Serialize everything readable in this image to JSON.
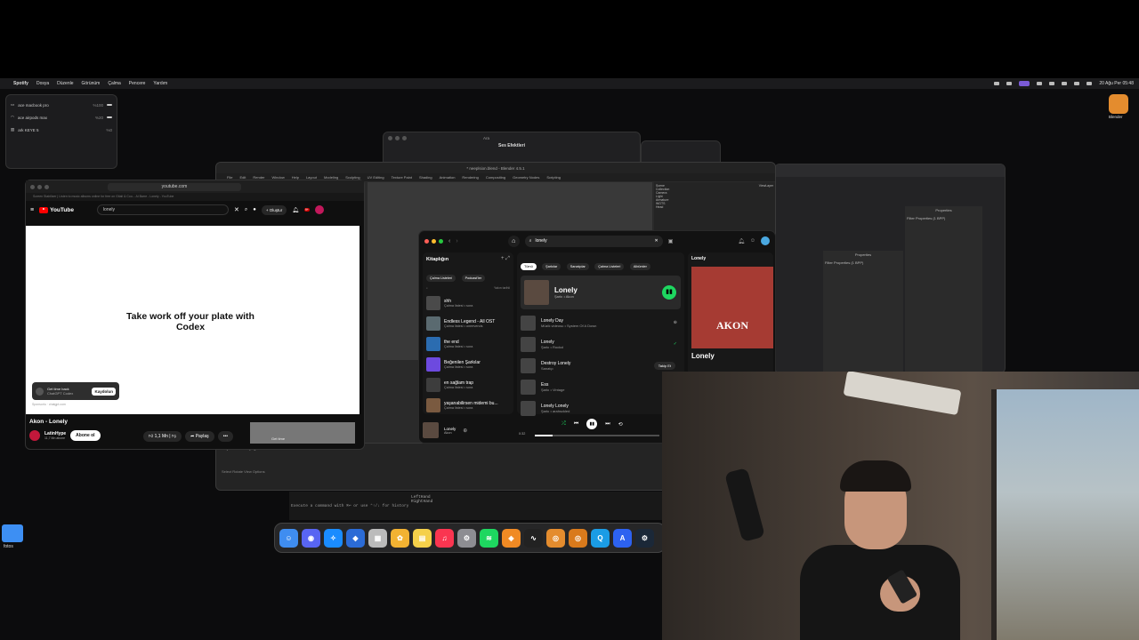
{
  "menubar": {
    "app": "Spotify",
    "items": [
      "Dosya",
      "Düzenle",
      "Görünüm",
      "Çalma",
      "Pencere",
      "Yardım"
    ],
    "clock": "20 Ağu Per  05:48"
  },
  "audio_popup": {
    "devices": [
      {
        "name": "ace macbook pro",
        "level": "%100"
      },
      {
        "name": "ace airpods max",
        "level": "%20"
      },
      {
        "name": "ark KEYE 5",
        "level": "%0"
      }
    ]
  },
  "desktop": {
    "folder_label": "fotos",
    "blender_label": "Blender"
  },
  "back_window": {
    "title": "Ses Efektleri",
    "search": "Ara"
  },
  "blender": {
    "title": "* neeplsion.blend - Blender 4.5.1",
    "menu": [
      "File",
      "Edit",
      "Render",
      "Window",
      "Help",
      "Layout",
      "Modeling",
      "Sculpting",
      "UV Editing",
      "Texture Paint",
      "Shading",
      "Animation",
      "Rendering",
      "Compositing",
      "Geometry Nodes",
      "Scripting"
    ],
    "outliner_title": "Scene",
    "view_layer": "ViewLayer",
    "outliner_items": [
      "Collection",
      "Camera",
      "Light",
      "Armature",
      "WGTS",
      "Head"
    ],
    "properties_title": "Properties",
    "filter_properties": "Filter Properties (1 BPP)",
    "timeline_labels": [
      "Playback",
      "Keying",
      "View",
      "Marker"
    ],
    "status": "Select  Rotate View  Options",
    "armature": [
      "LeftHand",
      "RightHand"
    ]
  },
  "terminal": {
    "line": "Execute a command with ⌘↩ or use ⌃↑/↓ for history"
  },
  "youtube": {
    "url": "youtube.com",
    "tab_hint": "Screen Stabilizer | Listen to music albums online for free on Gitali & Cou...   Ai Barre - Lonely - YouTube",
    "logo": "YouTube",
    "search": "lonely",
    "create": "Oluştur",
    "notif_count": "9+",
    "ad_headline": "Take work off your plate with Codex",
    "ad_box_title": "Get time back",
    "ad_box_sub": "ChatGPT Codex",
    "ad_box_cta": "Kaydolun",
    "sponsored": "Sponsorlu · chatgpt.com",
    "video_title": "Akon - Lonely",
    "channel": "LatinHype",
    "subs": "11,7 Mn abone",
    "subscribe": "Abone ol",
    "likes": "1,1 Mn",
    "share": "Paylaş",
    "more": "•••",
    "side_ad": "Get time"
  },
  "spotify": {
    "search": "lonely",
    "library_title": "Kitaplığın",
    "lib_filters": [
      "Çalma Listeleri",
      "Podcast'ler"
    ],
    "lib_sort": "Yakın tarihli",
    "library": [
      {
        "title": "shh",
        "sub": "Çalma listesi • sora",
        "color": "#4a4a4a"
      },
      {
        "title": "Endless Legend - All OST",
        "sub": "Çalma listesi • oneevends",
        "color": "#5a6a70"
      },
      {
        "title": "the end",
        "sub": "Çalma listesi • sora",
        "color": "#2b6cb0"
      },
      {
        "title": "Beğenilen Şarkılar",
        "sub": "Çalma listesi • sora",
        "color": "#6d4adf"
      },
      {
        "title": "en sağlam trap",
        "sub": "Çalma listesi • sora",
        "color": "#3d3d3d"
      },
      {
        "title": "yaşanabilirsen midemi bu...",
        "sub": "Çalma listesi • sora",
        "color": "#7a5a40"
      }
    ],
    "filters": [
      "Tümü",
      "Şarkılar",
      "Sanatçılar",
      "Çalma Listeleri",
      "Albümler"
    ],
    "top_result": {
      "title": "Lonely",
      "sub": "Şarkı • Akon"
    },
    "songs": [
      {
        "title": "Lonely Day",
        "sub": "Müzik videosu • System Of A Down",
        "right": "⊕"
      },
      {
        "title": "Lonely",
        "sub": "Şarkı • Rockol",
        "right": "✓"
      },
      {
        "title": "Destroy Lonely",
        "sub": "Sanatçı",
        "right": "Takip Et"
      },
      {
        "title": "Ess",
        "sub": "Şarkı • Vintage",
        "right": ""
      },
      {
        "title": "Lonely Lonely",
        "sub": "Şarkı • arahsckled",
        "right": ""
      }
    ],
    "now_playing_title": "Lonely",
    "now_playing_artist": "Akon",
    "side_header": "Lonely",
    "side_title": "Lonely",
    "side_art_text": "AKON",
    "time_elapsed": "0:32",
    "time_total": "3:55",
    "progress_fraction": 0.14
  },
  "dock": {
    "apps": [
      {
        "name": "finder",
        "color": "#3f8df0",
        "glyph": "☺"
      },
      {
        "name": "discord",
        "color": "#5865f2",
        "glyph": "◉"
      },
      {
        "name": "safari",
        "color": "#1a8cff",
        "glyph": "✧"
      },
      {
        "name": "roblox",
        "color": "#2b6bd6",
        "glyph": "◆"
      },
      {
        "name": "launchpad",
        "color": "#bbbbbb",
        "glyph": "▦"
      },
      {
        "name": "photos",
        "color": "#f2b232",
        "glyph": "✿"
      },
      {
        "name": "notes",
        "color": "#f5d04a",
        "glyph": "▤"
      },
      {
        "name": "music",
        "color": "#fa3550",
        "glyph": "♫"
      },
      {
        "name": "settings",
        "color": "#8d8d92",
        "glyph": "⚙"
      },
      {
        "name": "spotify",
        "color": "#1ed760",
        "glyph": "≋"
      },
      {
        "name": "app-orange",
        "color": "#f08a24",
        "glyph": "◈"
      },
      {
        "name": "activity-monitor",
        "color": "#222222",
        "glyph": "∿"
      },
      {
        "name": "blender",
        "color": "#e48c2e",
        "glyph": "◎"
      },
      {
        "name": "blender-2",
        "color": "#d97a1c",
        "glyph": "◎"
      },
      {
        "name": "quicktime",
        "color": "#1b9ce5",
        "glyph": "Q"
      },
      {
        "name": "arc",
        "color": "#2d62f0",
        "glyph": "A"
      },
      {
        "name": "steam",
        "color": "#1b2838",
        "glyph": "⚙"
      }
    ]
  }
}
